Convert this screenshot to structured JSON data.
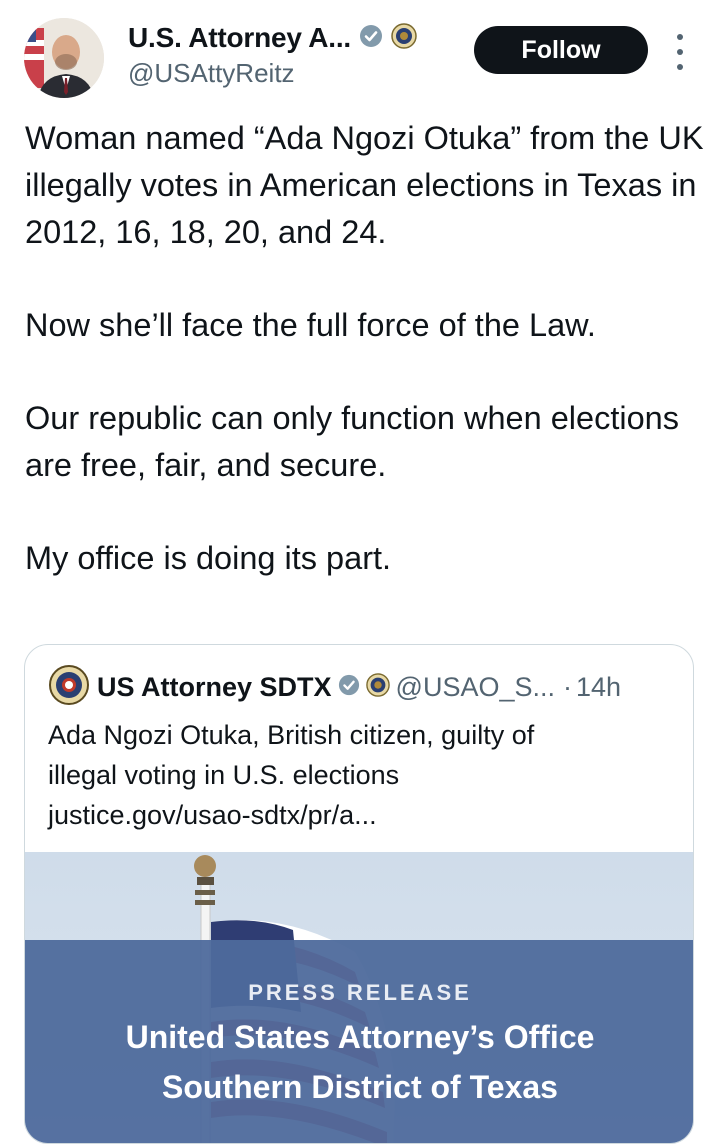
{
  "author": {
    "display_name": "U.S. Attorney A...",
    "handle": "@USAttyReitz",
    "verified": true,
    "affiliation_badge": "doj-seal-icon"
  },
  "actions": {
    "follow_label": "Follow",
    "more_icon": "more-vertical-icon"
  },
  "tweet": {
    "paragraphs": [
      "Woman named “Ada Ngozi Otuka” from the UK illegally votes in American elections in Texas in 2012, 16, 18, 20, and 24.",
      "Now she’ll face the full force of the Law.",
      "Our republic can only function when elections are free, fair, and secure.",
      "My office is doing its part."
    ]
  },
  "quote": {
    "display_name": "US Attorney SDTX",
    "handle": "@USAO_S...",
    "separator": "·",
    "time": "14h",
    "text_lines": [
      "Ada Ngozi Otuka, British citizen, guilty of",
      "illegal voting in U.S. elections",
      "justice.gov/usao-sdtx/pr/a..."
    ],
    "media": {
      "label": "PRESS   RELEASE",
      "title_line1": "United States Attorney’s Office",
      "title_line2": "Southern District of Texas"
    }
  },
  "colors": {
    "text": "#0f1419",
    "secondary": "#536471",
    "border": "#cfd9de",
    "verified": "#829aab",
    "banner": "#4e6a9c"
  }
}
